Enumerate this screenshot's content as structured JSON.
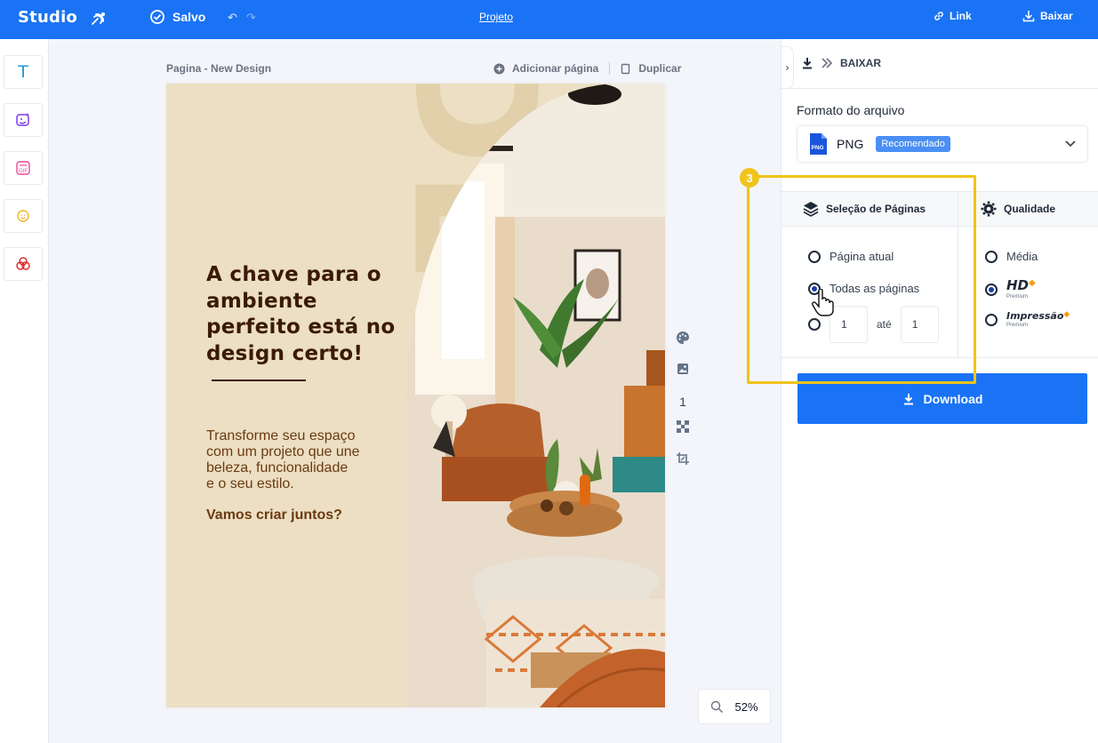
{
  "topbar": {
    "logo": "Studio",
    "saved": "Salvo",
    "undo_icon": "↶",
    "redo_icon": "↷",
    "project": "Projeto",
    "link": "Link",
    "download": "Baixar"
  },
  "tools": [
    {
      "name": "text-tool",
      "glyph": "T",
      "color": "#1a9be0"
    },
    {
      "name": "ai-image-tool",
      "glyph": "✦",
      "color": "#7c3aed"
    },
    {
      "name": "gif-tool",
      "glyph": "GIF",
      "color": "#ec4899"
    },
    {
      "name": "emoji-tool",
      "glyph": "☺",
      "color": "#f0b429"
    },
    {
      "name": "shapes-tool",
      "glyph": "⚭",
      "color": "#dc2626"
    }
  ],
  "canvas": {
    "page_label": "Pagina - New Design",
    "add_page": "Adicionar página",
    "duplicate": "Duplicar",
    "page_number": "1",
    "zoom": "52%"
  },
  "design": {
    "headline": "A chave para o ambiente perfeito está no design certo!",
    "body": "Transforme seu espaço\ncom um projeto que une\nbeleza, funcionalidade\ne o seu estilo.",
    "cta": "Vamos criar juntos?",
    "background_word": "DESIGN",
    "colors": {
      "bg": "#ecdfc3",
      "text_dark": "#3b1a07",
      "text_brown": "#6b3a12"
    }
  },
  "panel": {
    "title": "BAIXAR",
    "format_label": "Formato do arquivo",
    "format_value": "PNG",
    "format_icon_text": "PNG",
    "recommended": "Recomendado",
    "tab_pages": "Seleção de Páginas",
    "tab_quality": "Qualidade",
    "page_options": {
      "current": "Página atual",
      "all": "Todas as páginas",
      "range_from": "1",
      "range_to_label": "até",
      "range_to": "1",
      "selected": "all"
    },
    "quality_options": {
      "medium": "Média",
      "hd": "HD",
      "hd_sub": "Premium",
      "print": "Impressão",
      "print_sub": "Premium",
      "selected": "hd"
    },
    "download_button": "Download"
  },
  "annotation": {
    "step": "3",
    "color": "#f0c419"
  },
  "accent": "#1a73f5"
}
